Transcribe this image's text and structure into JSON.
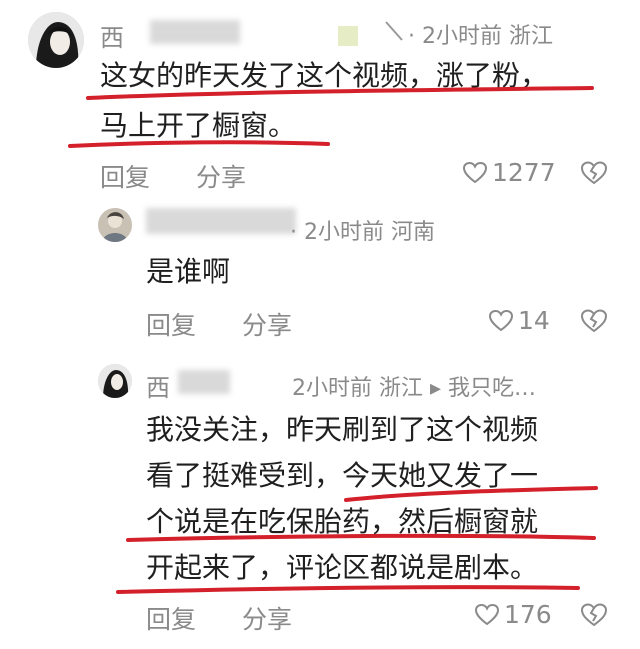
{
  "comments": [
    {
      "name_visible": "西",
      "meta_text": "2小时前 浙江",
      "lines": [
        "这女的昨天发了这个视频，涨了粉，",
        "马上开了橱窗。"
      ],
      "reply_label": "回复",
      "share_label": "分享",
      "likes": "1277"
    },
    {
      "name_visible": "",
      "meta_text": "2小时前 河南",
      "lines": [
        "是谁啊"
      ],
      "reply_label": "回复",
      "share_label": "分享",
      "likes": "14"
    },
    {
      "name_visible": "西",
      "meta_text": "2小时前 浙江 ▸ 我只吃…",
      "lines": [
        "我没关注，昨天刷到了这个视频",
        "看了挺难受到，今天她又发了一",
        "个说是在吃保胎药，然后橱窗就",
        "开起来了，评论区都说是剧本。"
      ],
      "reply_label": "回复",
      "share_label": "分享",
      "likes": "176"
    }
  ],
  "icons": {
    "like": "heart-outline-icon",
    "dislike": "broken-heart-icon",
    "avatar": "user-avatar"
  },
  "colors": {
    "underline": "#d3202a",
    "meta_gray": "#8a8a8a",
    "text": "#1f1f1f"
  }
}
